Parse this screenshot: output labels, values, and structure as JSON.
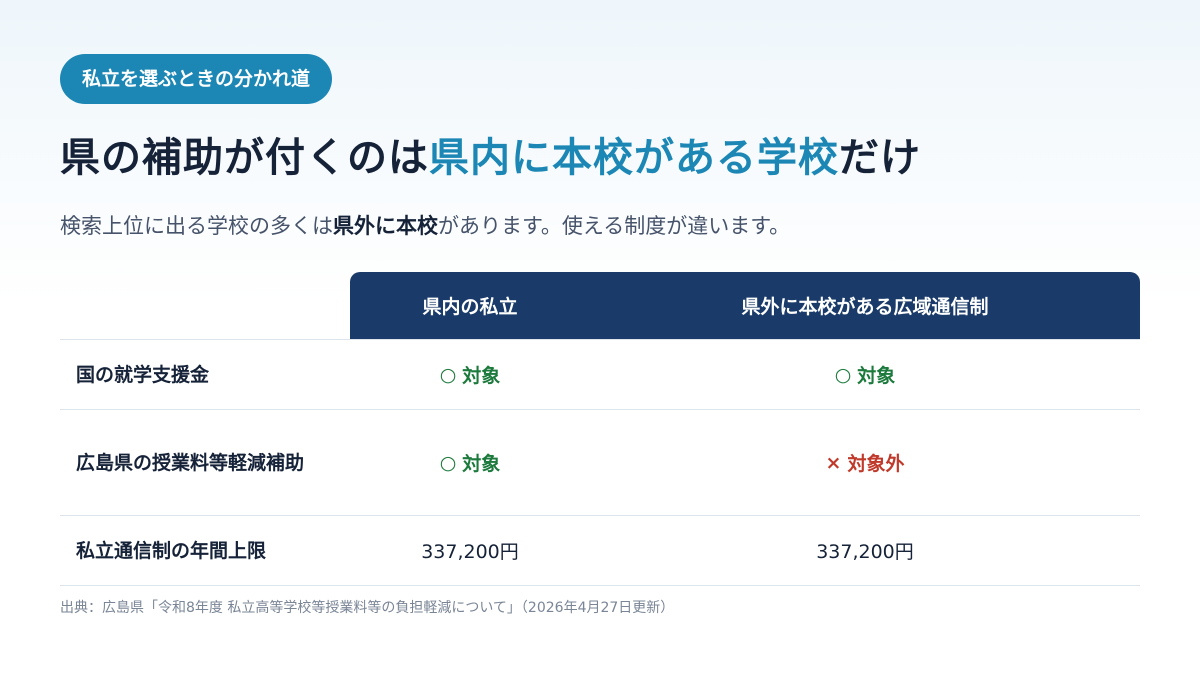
{
  "badge": "私立を選ぶときの分かれ道",
  "title": {
    "part1": "県の補助が付くのは",
    "highlight": "県内に本校がある学校",
    "part2": "だけ"
  },
  "subtitle": {
    "part1": "検索上位に出る学校の多くは",
    "bold": "県外に本校",
    "part2": "があります。使える制度が違います。"
  },
  "table": {
    "headers": [
      "県内の私立",
      "県外に本校がある広域通信制"
    ],
    "rows": [
      {
        "label": "国の就学支援金",
        "cells": [
          {
            "mark": "○",
            "text": "対象",
            "status": "ok"
          },
          {
            "mark": "○",
            "text": "対象",
            "status": "ok"
          }
        ]
      },
      {
        "label": "広島県の授業料等軽減補助",
        "cells": [
          {
            "mark": "○",
            "text": "対象",
            "status": "ok"
          },
          {
            "mark": "×",
            "text": "対象外",
            "status": "ng"
          }
        ]
      },
      {
        "label": "私立通信制の年間上限",
        "cells": [
          {
            "mark": "",
            "text": "337,200円",
            "status": "amount"
          },
          {
            "mark": "",
            "text": "337,200円",
            "status": "amount"
          }
        ]
      }
    ]
  },
  "source": "出典：広島県「令和8年度 私立高等学校等授業料等の負担軽減について」（2026年4月27日更新）",
  "colors": {
    "accent": "#1c87b5",
    "header_bg": "#1a3a69",
    "ok": "#1c7a3c",
    "ng": "#c03a2b"
  }
}
